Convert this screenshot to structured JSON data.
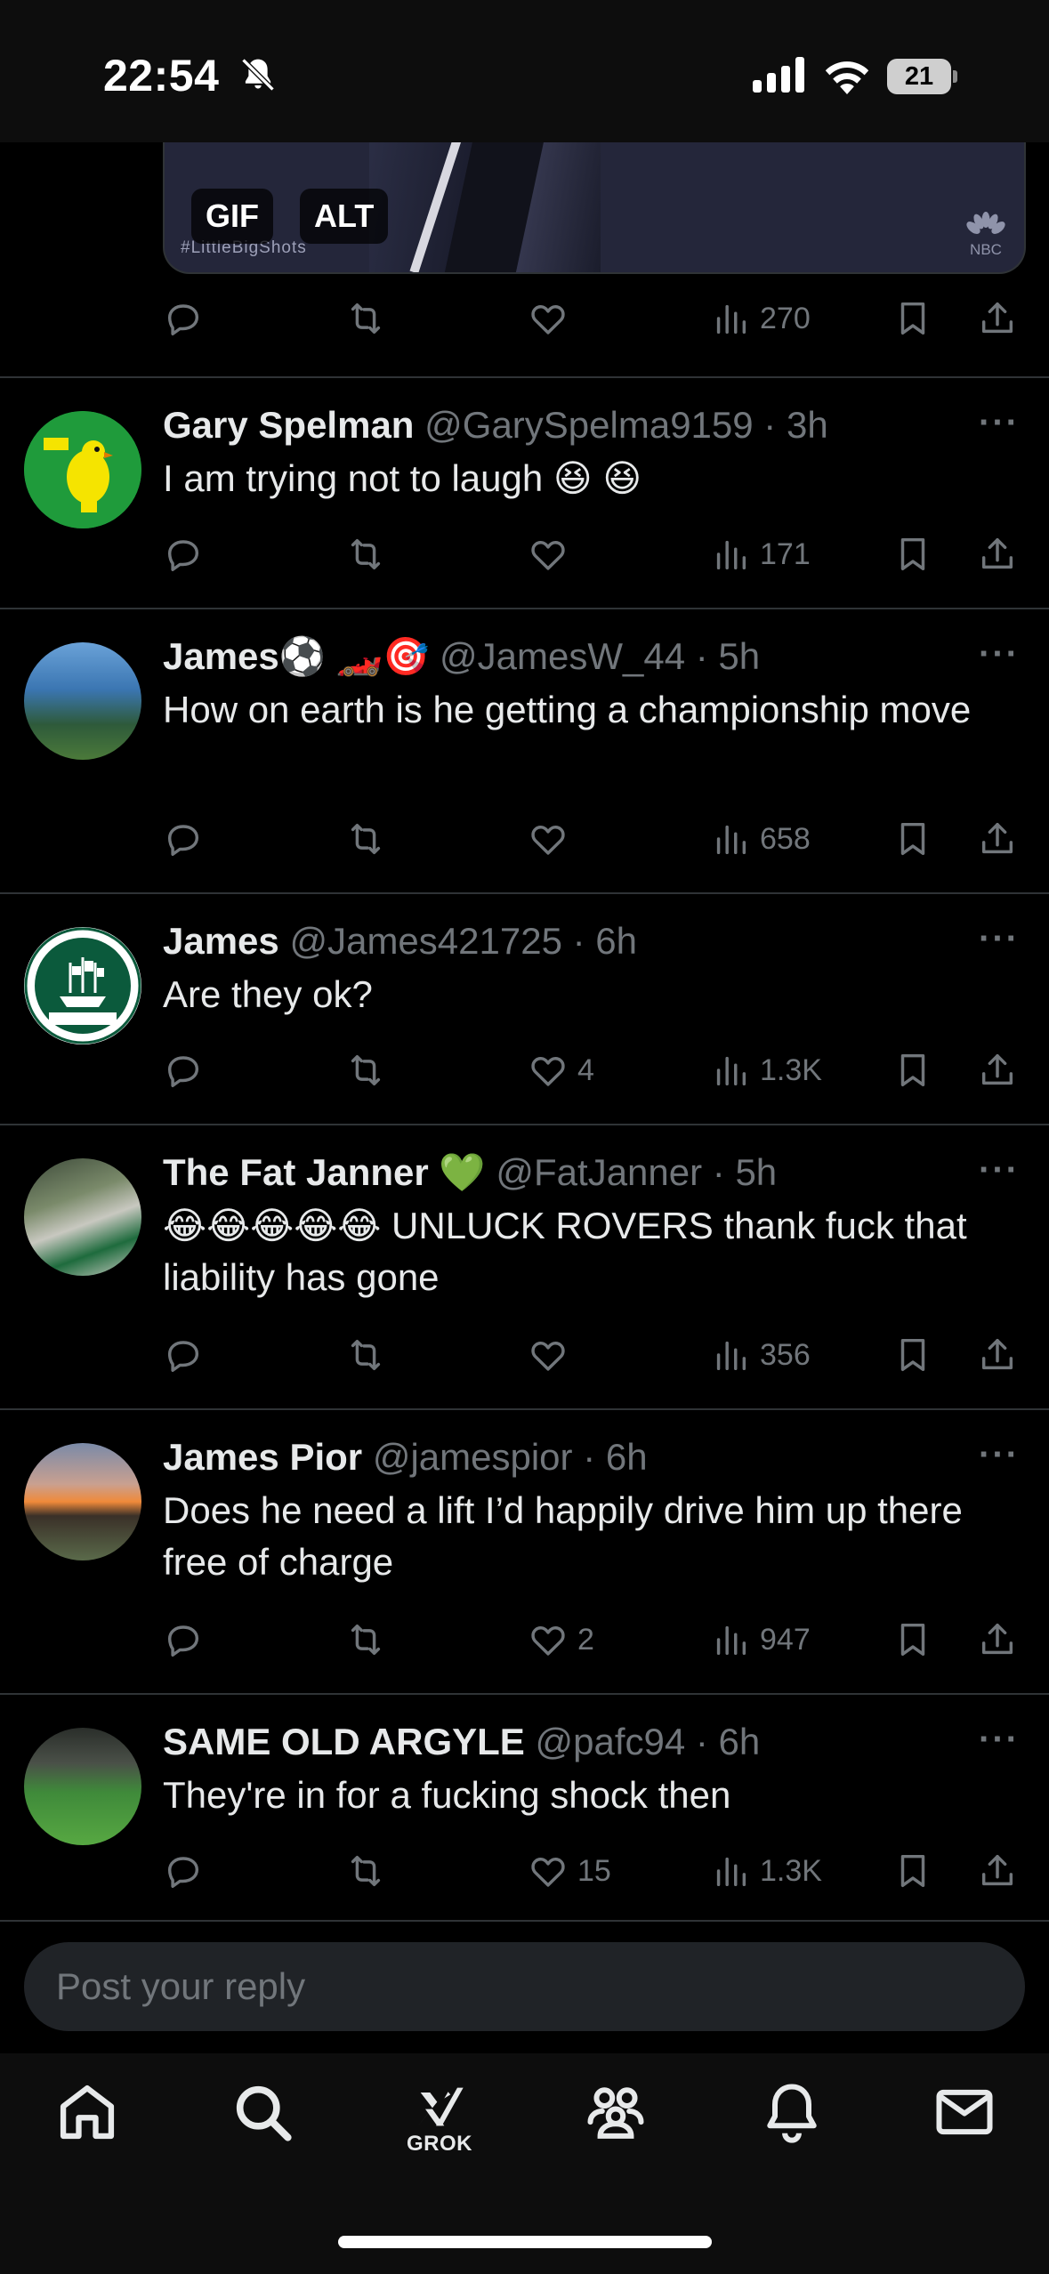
{
  "status_bar": {
    "time": "22:54",
    "battery": "21"
  },
  "media": {
    "tag": "#LittleBigShots",
    "gif_label": "GIF",
    "alt_label": "ALT",
    "network": "NBC"
  },
  "main_post_actions": {
    "views": "270"
  },
  "replies": [
    {
      "name": "Gary Spelman",
      "handle": "@GarySpelma9159",
      "time": "3h",
      "text": "I am trying not to laugh 😆 😆",
      "likes": "",
      "views": "171"
    },
    {
      "name": "James⚽️ 🏎️🎯",
      "handle": "@JamesW_44",
      "time": "5h",
      "text": "How on earth is he getting a championship move",
      "likes": "",
      "views": "658"
    },
    {
      "name": "James",
      "handle": "@James421725",
      "time": "6h",
      "text": "Are they ok?",
      "likes": "4",
      "views": "1.3K"
    },
    {
      "name": "The Fat Janner 💚",
      "handle": "@FatJanner",
      "time": "5h",
      "text": "😂😂😂😂😂 UNLUCK ROVERS thank fuck that liability has gone",
      "likes": "",
      "views": "356"
    },
    {
      "name": "James Pior",
      "handle": "@jamespior",
      "time": "6h",
      "text": "Does he need a lift I’d happily drive him up there free of charge",
      "likes": "2",
      "views": "947"
    },
    {
      "name": "SAME OLD ARGYLE",
      "handle": "@pafc94",
      "time": "6h",
      "text": "They're in for a fucking shock then",
      "likes": "15",
      "views": "1.3K"
    }
  ],
  "composer": {
    "placeholder": "Post your reply"
  },
  "nav": {
    "grok_label": "GROK"
  },
  "colors": {
    "background": "#000000",
    "text": "#e7e9ea",
    "muted": "#71767b",
    "divider": "#2f3336"
  }
}
